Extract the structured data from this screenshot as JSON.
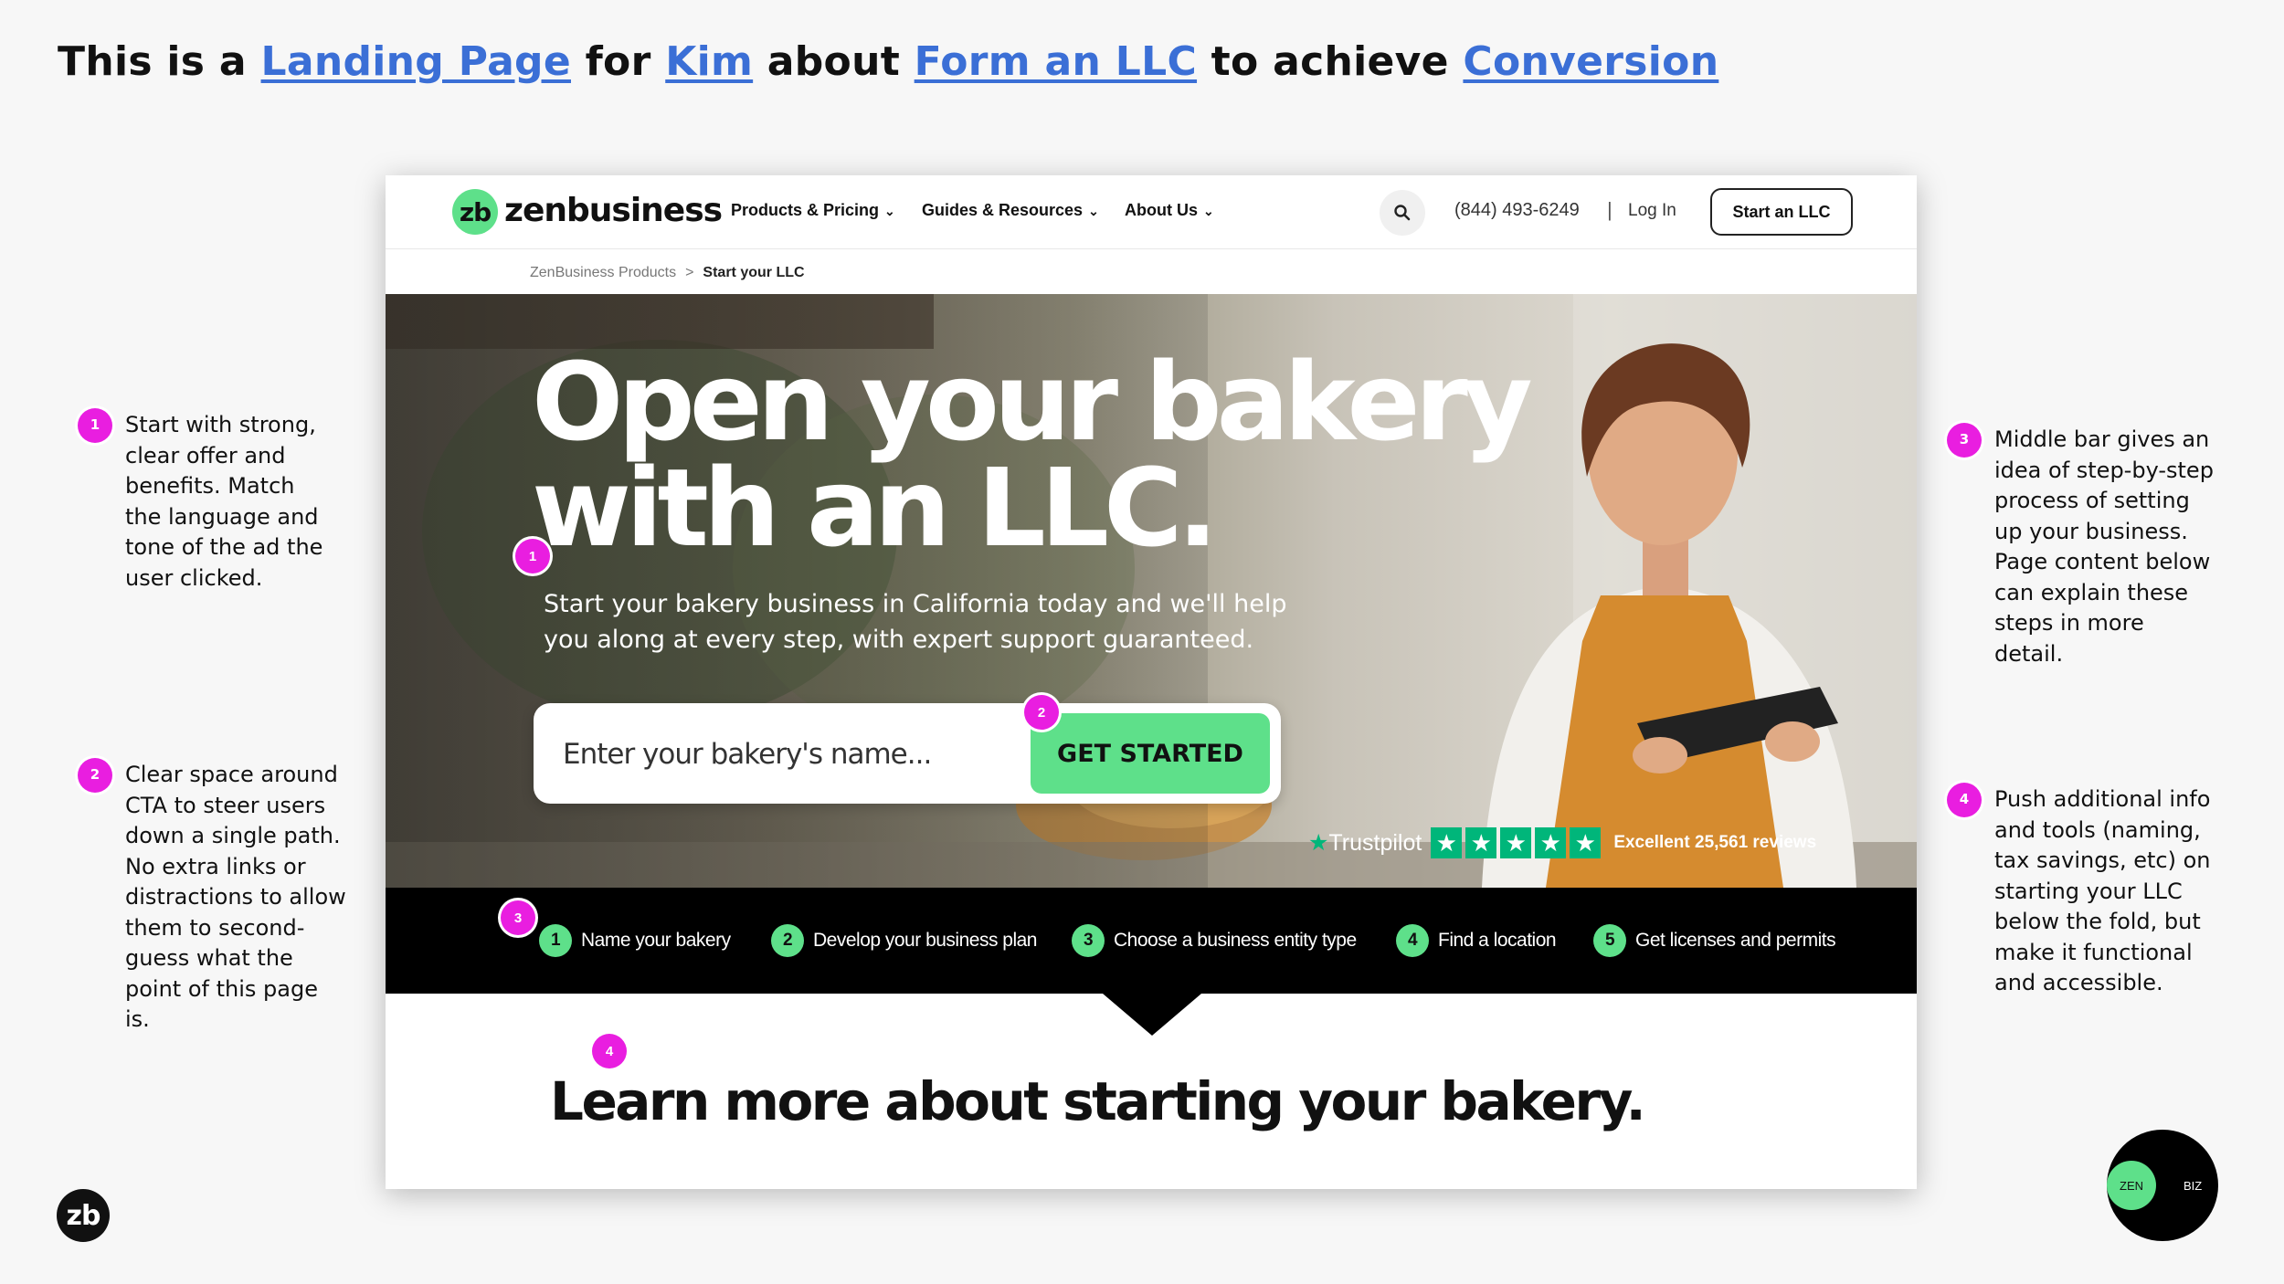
{
  "slide": {
    "title_parts": [
      "This is a ",
      "Landing Page",
      " for ",
      "Kim",
      " about ",
      "Form an LLC",
      " to achieve ",
      "Conversion"
    ],
    "notes": [
      {
        "badge": "1",
        "text": "Start with strong, clear offer and benefits. Match the language and tone of the ad the user clicked."
      },
      {
        "badge": "2",
        "text": "Clear space around CTA to steer users down a single path. No extra links or distractions to allow them to second-guess what the point of this page is."
      },
      {
        "badge": "3",
        "text": "Middle bar gives an idea of step-by-step process of setting up your business. Page content below can explain these steps in more detail."
      },
      {
        "badge": "4",
        "text": "Push additional info and tools (naming, tax savings, etc) on starting your LLC below the fold, but make it functional and accessible."
      }
    ],
    "corner_logo": "zb",
    "zenbiz": {
      "zen": "ZEN",
      "biz": "BIZ"
    },
    "colors": {
      "link": "#3b6fd6",
      "badge": "#e91ee0",
      "brand_green": "#5ee08a"
    }
  },
  "site": {
    "logo_mark": "zb",
    "logo_word": "zenbusiness",
    "nav": [
      "Products & Pricing",
      "Guides & Resources",
      "About Us"
    ],
    "search_icon": "search-icon",
    "phone": "(844) 493-6249",
    "separator": "|",
    "login": "Log In",
    "start_button": "Start an LLC",
    "breadcrumb": {
      "parent": "ZenBusiness Products",
      "sep": ">",
      "current": "Start your LLC"
    },
    "hero": {
      "title_line1": "Open your bakery",
      "title_line2": "with an LLC.",
      "subtitle": "Start your bakery business in California today and we'll help you along at every step, with expert support guaranteed.",
      "input_placeholder": "Enter your bakery's name...",
      "cta": "GET STARTED",
      "trustpilot": {
        "brand": "Trustpilot",
        "stars": 5,
        "text": "Excellent 25,561 reviews"
      }
    },
    "steps": [
      {
        "num": "1",
        "label": "Name your bakery"
      },
      {
        "num": "2",
        "label": "Develop your business plan"
      },
      {
        "num": "3",
        "label": "Choose a business entity type"
      },
      {
        "num": "4",
        "label": "Find a location"
      },
      {
        "num": "5",
        "label": "Get licenses and permits"
      }
    ],
    "learn_more": "Learn more about starting your bakery."
  }
}
